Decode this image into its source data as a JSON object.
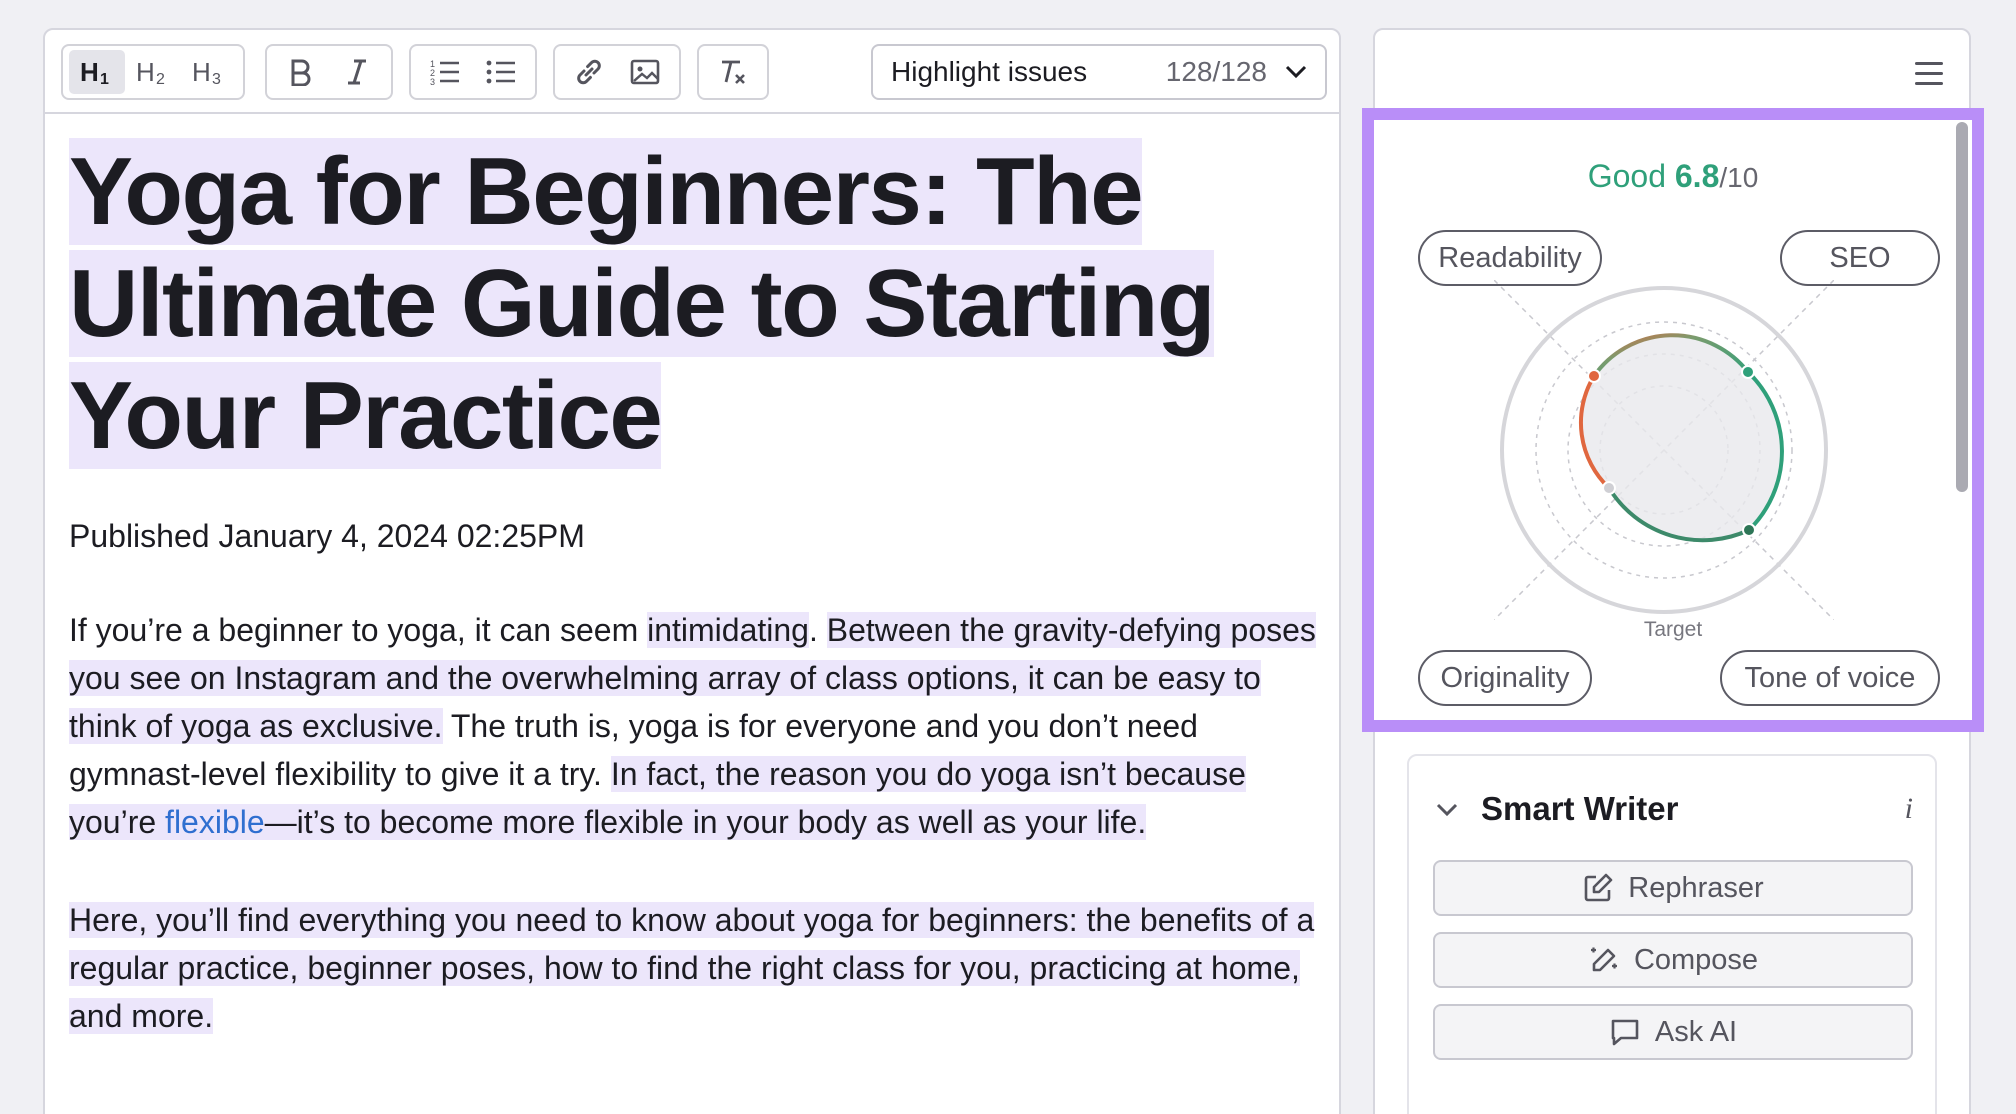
{
  "toolbar": {
    "headings": [
      "H1",
      "H2",
      "H3"
    ],
    "highlight": {
      "label": "Highlight issues",
      "count": "128/128"
    }
  },
  "article": {
    "title_lines": [
      "Yoga for Beginners: The",
      "Ultimate Guide to Starting",
      "Your Practice"
    ],
    "published": "Published January 4, 2024 02:25PM",
    "p1": {
      "s1a": "If you’re a beginner to yoga, it can seem ",
      "s1b": "intimidating",
      "s1c": ". ",
      "s2": "Between the gravity-defying poses you see on Instagram and the overwhelming array of class options, it can be easy to think of yoga as exclusive.",
      "s3": " The truth is, yoga is for everyone and you don’t need gymnast-level flexibility to give it a try. ",
      "s4a": "In fact, the reason you do yoga isn’t because you’re ",
      "s4link": "flexible",
      "s4b": "—it’s to become more flexible in your body as well as your life."
    },
    "p2": "Here, you’ll find everything you need to know about yoga for beginners: the benefits of a regular practice, beginner poses, how to find the right class for you, practicing at home, and more."
  },
  "score": {
    "rating": "Good",
    "value": "6.8",
    "max": "/10",
    "target_label": "Target",
    "categories": [
      "Readability",
      "SEO",
      "Originality",
      "Tone of voice"
    ]
  },
  "smart_writer": {
    "title": "Smart Writer",
    "info": "i",
    "buttons": [
      "Rephraser",
      "Compose",
      "Ask AI"
    ]
  },
  "colors": {
    "accent_frame": "#b98ef8",
    "highlight": "#ece6fb",
    "good": "#2fa07a",
    "warn": "#e0673f",
    "link": "#2f6fd0"
  }
}
